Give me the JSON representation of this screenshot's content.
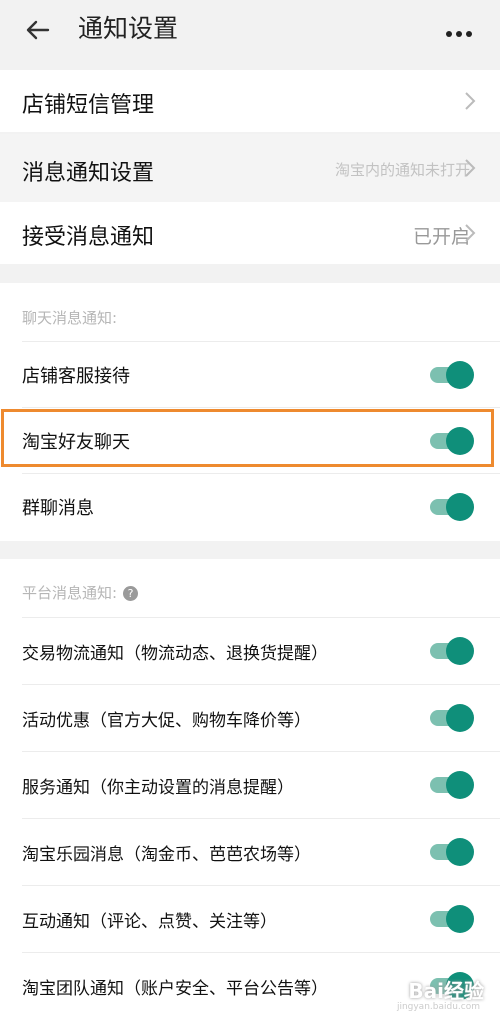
{
  "header": {
    "title": "通知设置"
  },
  "menu_rows": [
    {
      "label": "店铺短信管理",
      "value": ""
    },
    {
      "label": "消息通知设置",
      "value": "淘宝内的通知未打开"
    },
    {
      "label": "接受消息通知",
      "value": "已开启"
    }
  ],
  "chat_section": {
    "title": "聊天消息通知:",
    "items": [
      {
        "label": "店铺客服接待",
        "enabled": true
      },
      {
        "label": "淘宝好友聊天",
        "enabled": true
      },
      {
        "label": "群聊消息",
        "enabled": true
      }
    ]
  },
  "platform_section": {
    "title": "平台消息通知:",
    "help": "?",
    "items": [
      {
        "label": "交易物流通知（物流动态、退换货提醒）",
        "enabled": true
      },
      {
        "label": "活动优惠（官方大促、购物车降价等）",
        "enabled": true
      },
      {
        "label": "服务通知（你主动设置的消息提醒）",
        "enabled": true
      },
      {
        "label": "淘宝乐园消息（淘金币、芭芭农场等）",
        "enabled": true
      },
      {
        "label": "互动通知（评论、点赞、关注等）",
        "enabled": true
      },
      {
        "label": "淘宝团队通知（账户安全、平台公告等）",
        "enabled": true
      }
    ]
  },
  "watermark": {
    "text": "Bai经验",
    "sub": "jingyan.baidu.com"
  },
  "colors": {
    "toggle_on": "#0f8f7a",
    "highlight": "#ee8a2f"
  }
}
